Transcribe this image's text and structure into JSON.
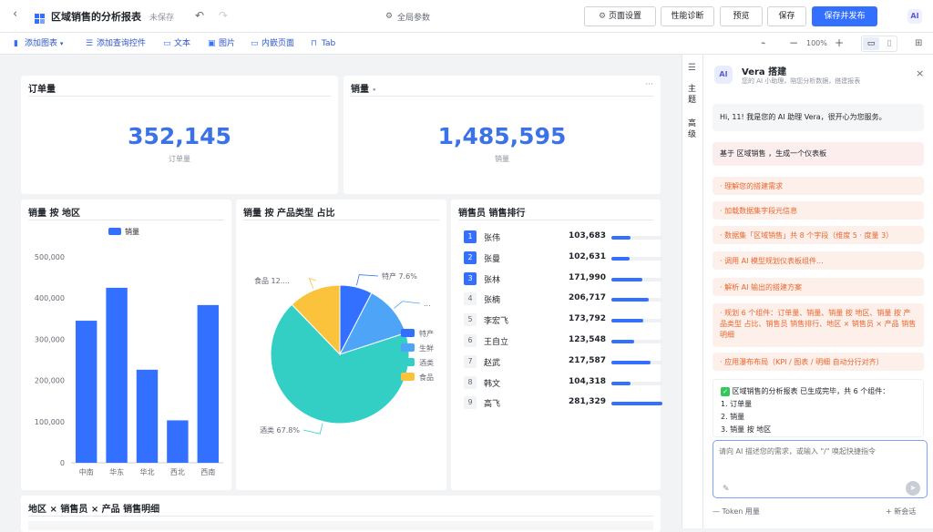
{
  "header": {
    "title": "区域销售的分析报表",
    "save_state": "未保存",
    "global_params": "全局参数",
    "buttons": {
      "page_settings": "页面设置",
      "perf": "性能诊断",
      "preview": "预览",
      "save": "保存",
      "save_publish": "保存并发布"
    }
  },
  "toolbar": {
    "add_chart": "添加图表",
    "add_query": "添加查询控件",
    "text": "文本",
    "image": "图片",
    "embed": "内嵌页面",
    "tab": "Tab",
    "zoom": "100%"
  },
  "cards": {
    "orders": {
      "title": "订单量",
      "value": "352,145",
      "label": "订单量"
    },
    "sales": {
      "title": "销量",
      "dot": "•",
      "value": "1,485,595",
      "label": "销量",
      "menu": "···"
    },
    "bar": {
      "title": "销量 按 地区",
      "legend": "销量"
    },
    "pie": {
      "title": "销量 按 产品类型 占比"
    },
    "rank": {
      "title": "销售员 销售排行"
    },
    "detail": {
      "title": "地区 × 销售员 × 产品 销售明细"
    }
  },
  "chart_data": [
    {
      "type": "bar",
      "title": "销量 按 地区",
      "categories": [
        "中南",
        "华东",
        "华北",
        "西北",
        "西南"
      ],
      "series": [
        {
          "name": "销量",
          "values": [
            345000,
            425000,
            226000,
            103000,
            383000
          ]
        }
      ],
      "ylim": [
        0,
        500000
      ],
      "yticks": [
        "0",
        "100,000",
        "200,000",
        "300,000",
        "400,000",
        "500,000"
      ],
      "legend": "top",
      "grid": false,
      "color": "#3370ff"
    },
    {
      "type": "pie",
      "title": "销量 按 产品类型 占比",
      "slices": [
        {
          "name": "特产",
          "value": 7.6
        },
        {
          "name": "生鲜",
          "value": 12.4
        },
        {
          "name": "酒类",
          "value": 67.8
        },
        {
          "name": "食品",
          "value": 12.2
        }
      ],
      "labels": {
        "te": "特产 7.6%",
        "sx": "...",
        "jl": "酒类 67.8%",
        "sp": "食品 12...."
      },
      "colors": [
        "#3370ff",
        "#4ea4f7",
        "#34cfc4",
        "#fbc23c"
      ],
      "legend": "right"
    }
  ],
  "ranking": [
    {
      "no": "1",
      "name": "张伟",
      "value": "103,683",
      "frac": 0.37
    },
    {
      "no": "2",
      "name": "张曼",
      "value": "102,631",
      "frac": 0.365
    },
    {
      "no": "3",
      "name": "张林",
      "value": "171,990",
      "frac": 0.61
    },
    {
      "no": "4",
      "name": "张楠",
      "value": "206,717",
      "frac": 0.74
    },
    {
      "no": "5",
      "name": "李宏飞",
      "value": "173,792",
      "frac": 0.62
    },
    {
      "no": "6",
      "name": "王自立",
      "value": "123,548",
      "frac": 0.44
    },
    {
      "no": "7",
      "name": "赵武",
      "value": "217,587",
      "frac": 0.77
    },
    {
      "no": "8",
      "name": "韩文",
      "value": "104,318",
      "frac": 0.37
    },
    {
      "no": "9",
      "name": "高飞",
      "value": "281,329",
      "frac": 1.0
    }
  ],
  "rail": {
    "theme": "主\n题",
    "advanced": "高\n级"
  },
  "panel": {
    "name": "Vera 搭建",
    "subtitle": "您的 AI 小助理，陪您分析数据，搭建报表",
    "greeting": "Hi, 11! 我是您的 AI 助理 Vera，很开心为您服务。",
    "request": "基于 区域销售 ，生成一个仪表板",
    "steps": [
      "· 理解您的搭建需求",
      "· 加载数据集字段元信息",
      "· 数据集「区域销售」共 8 个字段（维度 5 · 度量 3）",
      "· 调用 AI 模型规划仪表板组件...",
      "· 解析 AI 输出的搭建方案",
      "· 规划 6 个组件：订单量、销量、销量 按 地区、销量 按 产品类型 占比、销售员 销售排行、地区 × 销售员 × 产品 销售明细",
      "· 应用瀑布布局（KPI / 图表 / 明细 自动分行对齐）"
    ],
    "result": "区域销售的分析报表 已生成完毕，共 6 个组件：",
    "result_items": [
      "1. 订单量",
      "2. 销量",
      "3. 销量 按 地区"
    ],
    "input_placeholder": "请向 AI 描述您的需求，或输入 \"/\" 唤起快捷指令",
    "token": "Token 用量",
    "new_chat": "新会话"
  }
}
